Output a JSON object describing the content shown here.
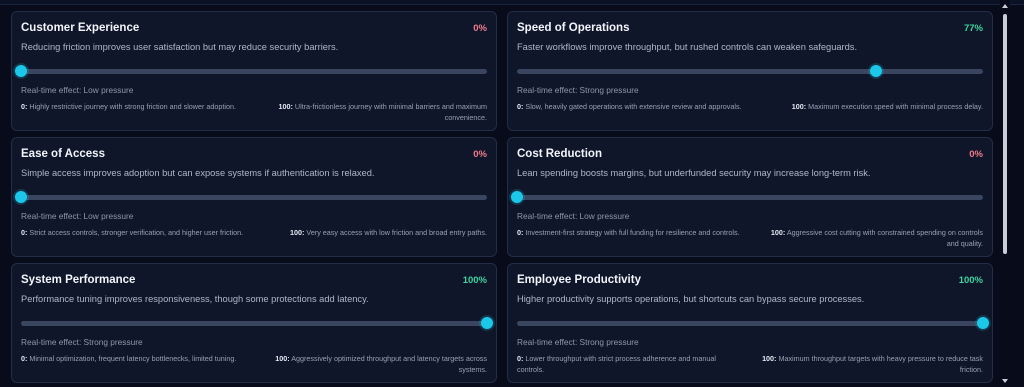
{
  "cards": [
    {
      "title": "Customer Experience",
      "percent_label": "0%",
      "value": 0,
      "description": "Reducing friction improves user satisfaction but may reduce security barriers.",
      "effect": "Real-time effect: Low pressure",
      "min_key": "0:",
      "min_text": "Highly restrictive journey with strong friction and slower adoption.",
      "max_key": "100:",
      "max_text": "Ultra-frictionless journey with minimal barriers and maximum convenience."
    },
    {
      "title": "Speed of Operations",
      "percent_label": "77%",
      "value": 77,
      "description": "Faster workflows improve throughput, but rushed controls can weaken safeguards.",
      "effect": "Real-time effect: Strong pressure",
      "min_key": "0:",
      "min_text": "Slow, heavily gated operations with extensive review and approvals.",
      "max_key": "100:",
      "max_text": "Maximum execution speed with minimal process delay."
    },
    {
      "title": "Ease of Access",
      "percent_label": "0%",
      "value": 0,
      "description": "Simple access improves adoption but can expose systems if authentication is relaxed.",
      "effect": "Real-time effect: Low pressure",
      "min_key": "0:",
      "min_text": "Strict access controls, stronger verification, and higher user friction.",
      "max_key": "100:",
      "max_text": "Very easy access with low friction and broad entry paths."
    },
    {
      "title": "Cost Reduction",
      "percent_label": "0%",
      "value": 0,
      "description": "Lean spending boosts margins, but underfunded security may increase long-term risk.",
      "effect": "Real-time effect: Low pressure",
      "min_key": "0:",
      "min_text": "Investment-first strategy with full funding for resilience and controls.",
      "max_key": "100:",
      "max_text": "Aggressive cost cutting with constrained spending on controls and quality."
    },
    {
      "title": "System Performance",
      "percent_label": "100%",
      "value": 100,
      "description": "Performance tuning improves responsiveness, though some protections add latency.",
      "effect": "Real-time effect: Strong pressure",
      "min_key": "0:",
      "min_text": "Minimal optimization, frequent latency bottlenecks, limited tuning.",
      "max_key": "100:",
      "max_text": "Aggressively optimized throughput and latency targets across systems."
    },
    {
      "title": "Employee Productivity",
      "percent_label": "100%",
      "value": 100,
      "description": "Higher productivity supports operations, but shortcuts can bypass secure processes.",
      "effect": "Real-time effect: Strong pressure",
      "min_key": "0:",
      "min_text": "Lower throughput with strict process adherence and manual controls.",
      "max_key": "100:",
      "max_text": "Maximum throughput targets with heavy pressure to reduce task friction."
    }
  ],
  "colors": {
    "low_percent": "#f47a8d",
    "high_percent": "#3fd5a0",
    "slider_knob": "#1cc8ea",
    "slider_track": "#3a4660"
  }
}
